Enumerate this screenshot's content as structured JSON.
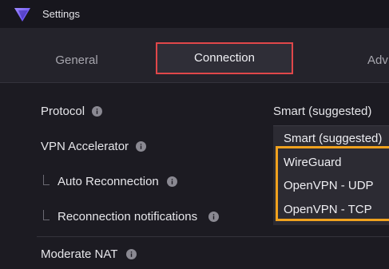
{
  "window": {
    "title": "Settings"
  },
  "tabs": {
    "general": "General",
    "connection": "Connection",
    "advanced": "Adv"
  },
  "settings": {
    "protocol_label": "Protocol",
    "protocol_value": "Smart (suggested)",
    "vpn_accelerator_label": "VPN Accelerator",
    "auto_reconnection_label": "Auto Reconnection",
    "reconnection_notifications_label": "Reconnection notifications",
    "moderate_nat_label": "Moderate NAT"
  },
  "protocol_dropdown": {
    "options": [
      "Smart (suggested)",
      "WireGuard",
      "OpenVPN - UDP",
      "OpenVPN - TCP"
    ]
  },
  "colors": {
    "accent_highlight_tab": "#e0474a",
    "accent_highlight_options": "#f0a21e",
    "logo": "#7b61ff"
  }
}
